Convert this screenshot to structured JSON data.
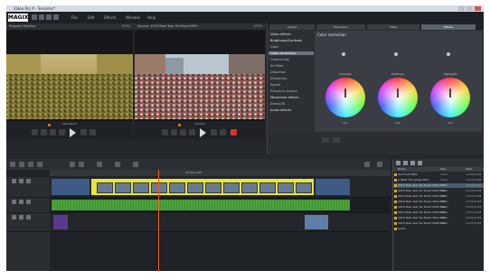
{
  "window": {
    "title": "Video Pro X - Sessions*"
  },
  "menu": {
    "items": [
      "File",
      "Edit",
      "Effects",
      "Window",
      "Help"
    ]
  },
  "logo": "MAGIX",
  "program_monitor": {
    "title": "Program Monitor",
    "label": "PROGRAM",
    "zoom": "100%"
  },
  "source_monitor": {
    "title": "Source: 2019 New Year Ski Event.MP4",
    "label": "SOURCE",
    "zoom": "100%"
  },
  "effects": {
    "tabs": [
      "Import",
      "Transitions",
      "Titles",
      "Effects"
    ],
    "active_tab": 3,
    "list": [
      {
        "label": "Video effects",
        "type": "hdr"
      },
      {
        "label": "Brightness/Contrast",
        "type": "hdr"
      },
      {
        "label": "Color",
        "type": "item"
      },
      {
        "label": "Color correction",
        "type": "sel"
      },
      {
        "label": "Chroma key",
        "type": "item"
      },
      {
        "label": "Art filter",
        "type": "item"
      },
      {
        "label": "Distortion",
        "type": "item"
      },
      {
        "label": "Sharpness",
        "type": "item"
      },
      {
        "label": "Speed",
        "type": "item"
      },
      {
        "label": "Picture in picture",
        "type": "item"
      },
      {
        "label": "Movement effects",
        "type": "hdr"
      },
      {
        "label": "Stereo3D",
        "type": "item"
      },
      {
        "label": "Audio effects",
        "type": "hdr"
      }
    ],
    "panel_title": "Color correction",
    "options": [
      "Shadows",
      "Midtones",
      "Highlights"
    ],
    "wheels": [
      {
        "label": "Shadows",
        "value": "0.0"
      },
      {
        "label": "Midtones",
        "value": "0.0"
      },
      {
        "label": "Highlights",
        "value": "0.0"
      }
    ]
  },
  "browser": {
    "columns": [
      "Name",
      "Type",
      "Date"
    ],
    "rows": [
      {
        "name": "Ski Event.MP4",
        "type": "Video",
        "date": "12/31/2018"
      },
      {
        "name": "A Walk The Ledge.MP4",
        "type": "Video",
        "date": "12/31/2018"
      },
      {
        "name": "2019 New Year Ski Event 0001.MP4",
        "type": "Video",
        "date": "12/31/2018",
        "sel": true
      },
      {
        "name": "2019 New Year Ski Event 0002.MP4",
        "type": "Video",
        "date": "12/31/2018"
      },
      {
        "name": "2019 New Year Ski Event 0003.MP4",
        "type": "Video",
        "date": "12/31/2018"
      },
      {
        "name": "2019 New Year Ski Event 0004.MP4",
        "type": "Video",
        "date": "12/31/2018"
      },
      {
        "name": "2019 New Year Ski Event 0005.MP4",
        "type": "Video",
        "date": "12/31/2018"
      },
      {
        "name": "2019 New Year Ski Event 0006.MP4",
        "type": "Video",
        "date": "12/31/2018"
      },
      {
        "name": "2019 New Year Ski Event 0007.MP4",
        "type": "Video",
        "date": "12/31/2018"
      },
      {
        "name": "2019 New Year Ski Event 0008.MP4",
        "type": "Video",
        "date": "12/31/2018"
      },
      {
        "name": "Audio",
        "type": "",
        "date": ""
      }
    ]
  },
  "timeline": {
    "ruler_label": "00:00:10:00"
  }
}
